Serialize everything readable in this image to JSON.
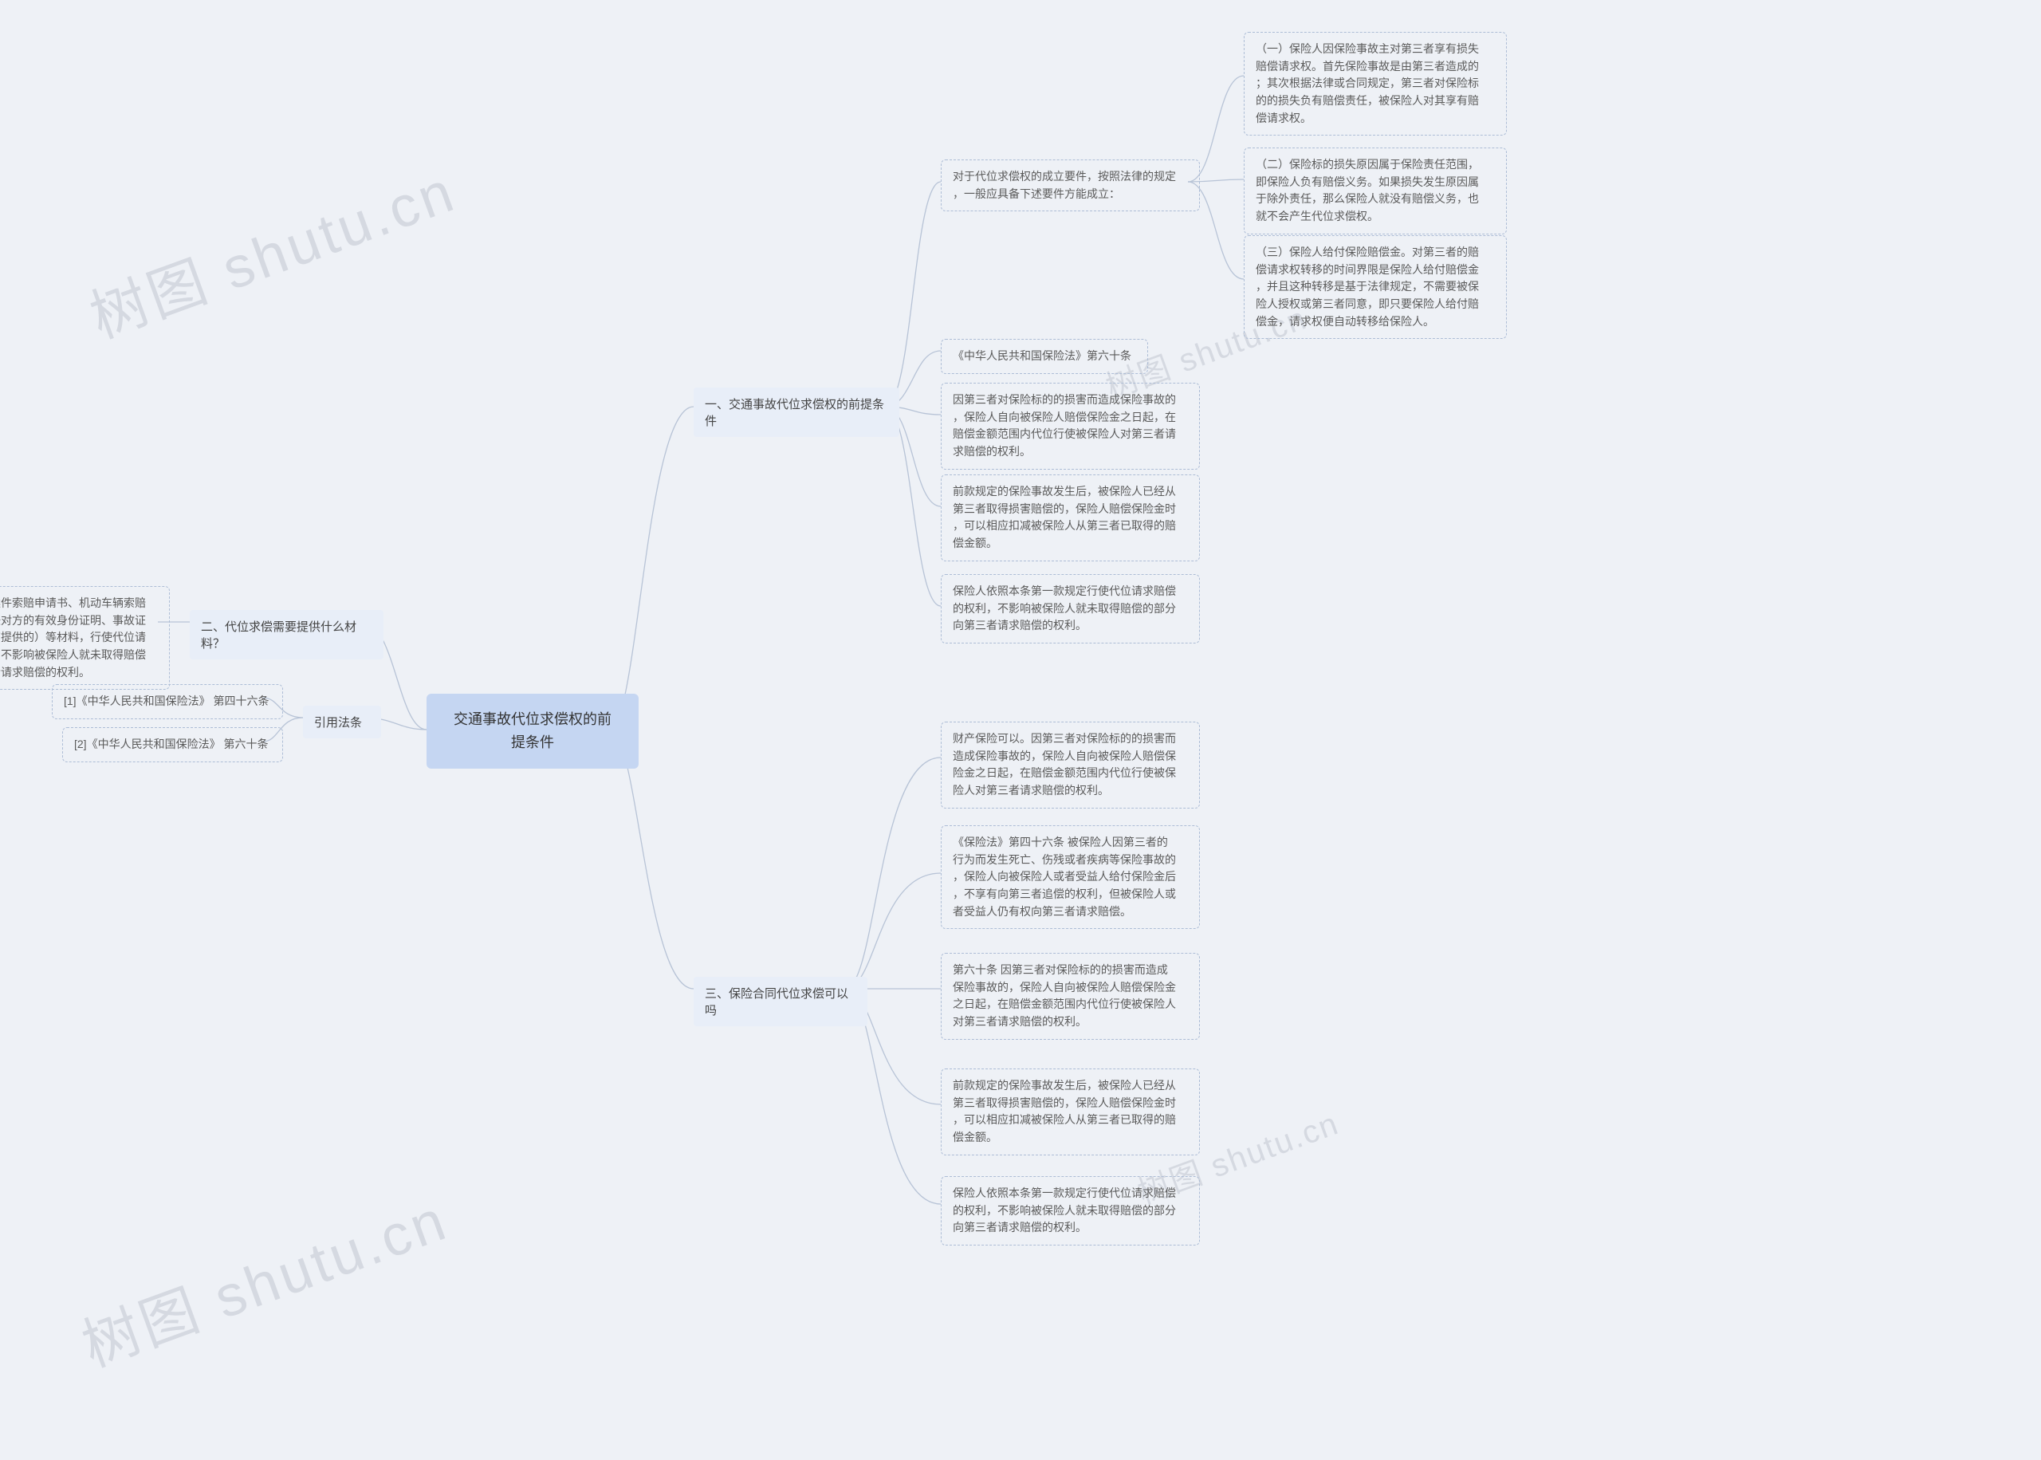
{
  "root": {
    "title_l1": "交通事故代位求偿权的前",
    "title_l2": "提条件"
  },
  "branch_1": {
    "label": "一、交通事故代位求偿权的前提条\n件"
  },
  "branch_2": {
    "label": "二、代位求偿需要提供什么材料？"
  },
  "branch_3": {
    "label": "三、保险合同代位求偿可以吗"
  },
  "branch_4": {
    "label": "引用法条"
  },
  "b1": {
    "req_intro": "对于代位求偿权的成立要件，按照法律的规定\n，一般应具备下述要件方能成立：",
    "req_1": "（一）保险人因保险事故主对第三者享有损失\n赔偿请求权。首先保险事故是由第三者造成的\n；其次根据法律或合同规定，第三者对保险标\n的的损失负有赔偿责任，被保险人对其享有赔\n偿请求权。",
    "req_2": "（二）保险标的损失原因属于保险责任范围，\n即保险人负有赔偿义务。如果损失发生原因属\n于除外责任，那么保险人就没有赔偿义务，也\n就不会产生代位求偿权。",
    "req_3": "（三）保险人给付保险赔偿金。对第三者的赔\n偿请求权转移的时间界限是保险人给付赔偿金\n，并且这种转移是基于法律规定，不需要被保\n险人授权或第三者同意，即只要保险人给付赔\n偿金，请求权便自动转移给保险人。",
    "law_ref": "《中华人民共和国保险法》第六十条",
    "p1": "因第三者对保险标的的损害而造成保险事故的\n，保险人自向被保险人赔偿保险金之日起，在\n赔偿金额范围内代位行使被保险人对第三者请\n求赔偿的权利。",
    "p2": "前款规定的保险事故发生后，被保险人已经从\n第三者取得损害赔偿的，保险人赔偿保险金时\n，可以相应扣减被保险人从第三者已取得的赔\n偿金额。",
    "p3": "保险人依照本条第一款规定行使代位请求赔偿\n的权利，不影响被保险人就未取得赔偿的部分\n向第三者请求赔偿的权利。"
  },
  "b2": {
    "materials": "代位求偿提供案件索赔申请书、机动车辆索赔\n权转让书、责任对方的有效身份证明、事故证\n明（报案时没有提供的）等材料，行使代位请\n求赔偿的权利，不影响被保险人就未取得赔偿\n的部分向第三者请求赔偿的权利。"
  },
  "b3": {
    "p1": "财产保险可以。因第三者对保险标的的损害而\n造成保险事故的，保险人自向被保险人赔偿保\n险金之日起，在赔偿金额范围内代位行使被保\n险人对第三者请求赔偿的权利。",
    "p2": "《保险法》第四十六条 被保险人因第三者的\n行为而发生死亡、伤残或者疾病等保险事故的\n，保险人向被保险人或者受益人给付保险金后\n，不享有向第三者追偿的权利，但被保险人或\n者受益人仍有权向第三者请求赔偿。",
    "p3": "第六十条 因第三者对保险标的的损害而造成\n保险事故的，保险人自向被保险人赔偿保险金\n之日起，在赔偿金额范围内代位行使被保险人\n对第三者请求赔偿的权利。",
    "p4": "前款规定的保险事故发生后，被保险人已经从\n第三者取得损害赔偿的，保险人赔偿保险金时\n，可以相应扣减被保险人从第三者已取得的赔\n偿金额。",
    "p5": "保险人依照本条第一款规定行使代位请求赔偿\n的权利，不影响被保险人就未取得赔偿的部分\n向第三者请求赔偿的权利。"
  },
  "b4": {
    "c1": "[1]《中华人民共和国保险法》 第四十六条",
    "c2": "[2]《中华人民共和国保险法》 第六十条"
  },
  "watermarks": {
    "t1": "树图 shutu.cn",
    "t2": "树图 shutu.cn",
    "t3": "树图 shutu.cn",
    "t4": "树图 shutu.cn"
  }
}
